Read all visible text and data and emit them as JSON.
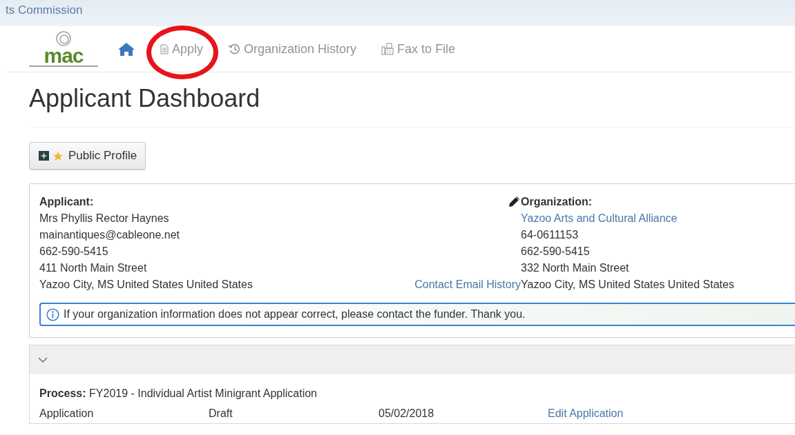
{
  "banner": {
    "title": "ts Commission"
  },
  "nav": {
    "logo_text": "mac",
    "items": [
      {
        "kind": "home"
      },
      {
        "kind": "doc",
        "label": "Apply",
        "circled": true
      },
      {
        "kind": "history",
        "label": "Organization History"
      },
      {
        "kind": "fax",
        "label": "Fax to File"
      }
    ]
  },
  "page_title": "Applicant Dashboard",
  "profile_button": "Public Profile",
  "applicant": {
    "heading": "Applicant:",
    "lines": [
      "Mrs Phyllis Rector Haynes",
      "mainantiques@cableone.net",
      "662-590-5415",
      "411 North Main Street",
      "Yazoo City, MS United States United States"
    ]
  },
  "contact_link": "Contact Email History",
  "organization": {
    "heading": "Organization:",
    "link": "Yazoo Arts and Cultural Alliance",
    "lines": [
      "64-0611153",
      "662-590-5415",
      "332 North Main Street",
      "Yazoo City, MS United States United States"
    ]
  },
  "alert": "If your organization information does not appear correct, please contact the funder. Thank you.",
  "process": {
    "expanded": true,
    "title": "**Process:** FY2019 - Individual Artist Minigrant Application",
    "row": [
      "Application",
      "Draft",
      "05/02/2018"
    ],
    "action": "Edit Application"
  }
}
